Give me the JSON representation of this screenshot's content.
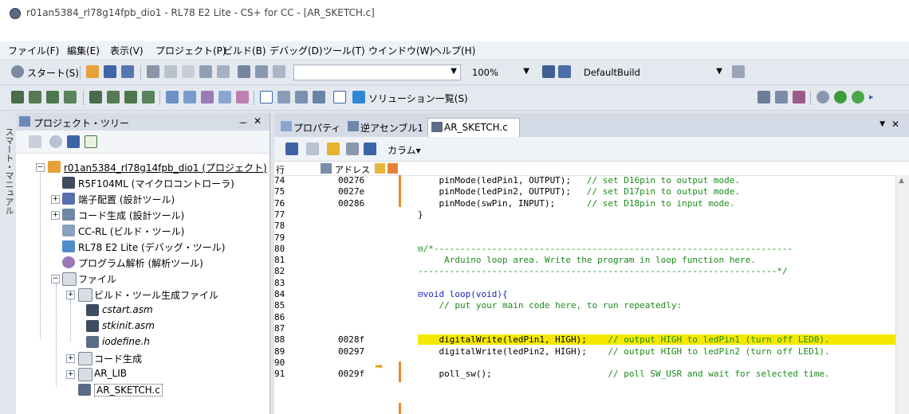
{
  "window": {
    "title": "r01an5384_rl78g14fpb_dio1 - RL78 E2 Lite - CS+ for CC - [AR_SKETCH.c]"
  },
  "menu": [
    "ファイル(F)",
    "編集(E)",
    "表示(V)",
    "プロジェクト(P)",
    "ビルド(B)",
    "デバッグ(D)",
    "ツール(T)",
    "ウインドウ(W)",
    "ヘルプ(H)"
  ],
  "toolbar1": {
    "start_label": "スタート(S)",
    "zoom_value": "100%",
    "build_config": "DefaultBuild"
  },
  "toolbar2": {
    "solution_list_label": "ソリューション一覧(S)"
  },
  "side_strip": {
    "label": "スマート・マニュアル"
  },
  "project_tree": {
    "title": "プロジェクト・ツリー",
    "pin": "ᅮ",
    "close": "✕",
    "items": [
      {
        "label": "r01an5384_rl78g14fpb_dio1 (プロジェクト)"
      },
      {
        "label": "R5F104ML (マイクロコントローラ)"
      },
      {
        "label": "端子配置 (設計ツール)"
      },
      {
        "label": "コード生成 (設計ツール)"
      },
      {
        "label": "CC-RL (ビルド・ツール)"
      },
      {
        "label": "RL78 E2 Lite (デバッグ・ツール)"
      },
      {
        "label": "プログラム解析 (解析ツール)"
      },
      {
        "label": "ファイル"
      },
      {
        "label": "ビルド・ツール生成ファイル"
      },
      {
        "label": "cstart.asm"
      },
      {
        "label": "stkinit.asm"
      },
      {
        "label": "iodefine.h"
      },
      {
        "label": "コード生成"
      },
      {
        "label": "AR_LIB"
      },
      {
        "label": "AR_SKETCH.c"
      }
    ]
  },
  "editor": {
    "tabs": [
      {
        "label": "プロパティ"
      },
      {
        "label": "逆アセンブル1"
      },
      {
        "label": "AR_SKETCH.c"
      }
    ],
    "column_label": "カラム▾",
    "header": {
      "line": "行",
      "address": "アドレス"
    },
    "lines": [
      {
        "n": "74",
        "addr": "00276",
        "text": "    pinMode(ledPin1, OUTPUT);   ",
        "comment": "// set D16pin to output mode."
      },
      {
        "n": "75",
        "addr": "0027e",
        "text": "    pinMode(ledPin2, OUTPUT);   ",
        "comment": "// set D17pin to output mode."
      },
      {
        "n": "76",
        "addr": "00286",
        "text": "    pinMode(swPin, INPUT);      ",
        "comment": "// set D18pin to input mode."
      },
      {
        "n": "77",
        "addr": "",
        "text": "}",
        "comment": ""
      },
      {
        "n": "78",
        "addr": "",
        "text": "",
        "comment": ""
      },
      {
        "n": "79",
        "addr": "",
        "text": "",
        "comment": ""
      },
      {
        "n": "80",
        "addr": "",
        "text": "",
        "comment": "⊟/*--------------------------------------------------------------------"
      },
      {
        "n": "81",
        "addr": "",
        "text": "",
        "comment": "     Arduino loop area. Write the program in loop function here."
      },
      {
        "n": "82",
        "addr": "",
        "text": "",
        "comment": "--------------------------------------------------------------------*/"
      },
      {
        "n": "83",
        "addr": "",
        "text": "",
        "comment": ""
      },
      {
        "n": "84",
        "addr": "",
        "text": "⊟void loop(void){",
        "comment": ""
      },
      {
        "n": "85",
        "addr": "",
        "text": "",
        "comment": "    // put your main code here, to run repeatedly:"
      },
      {
        "n": "86",
        "addr": "",
        "text": "",
        "comment": ""
      },
      {
        "n": "87",
        "addr": "",
        "text": "",
        "comment": ""
      },
      {
        "n": "88",
        "addr": "0028f",
        "text": "    digitalWrite(ledPin1, HIGH);    ",
        "comment": "// output HIGH to ledPin1 (turn off LED0)."
      },
      {
        "n": "89",
        "addr": "00297",
        "text": "    digitalWrite(ledPin2, HIGH);    ",
        "comment": "// output HIGH to ledPin2 (turn off LED1)."
      },
      {
        "n": "90",
        "addr": "",
        "text": "",
        "comment": ""
      },
      {
        "n": "91",
        "addr": "0029f",
        "text": "    poll_sw();                      ",
        "comment": "// poll SW_USR and wait for selected time."
      }
    ],
    "highlight_color": "#f5e800"
  }
}
